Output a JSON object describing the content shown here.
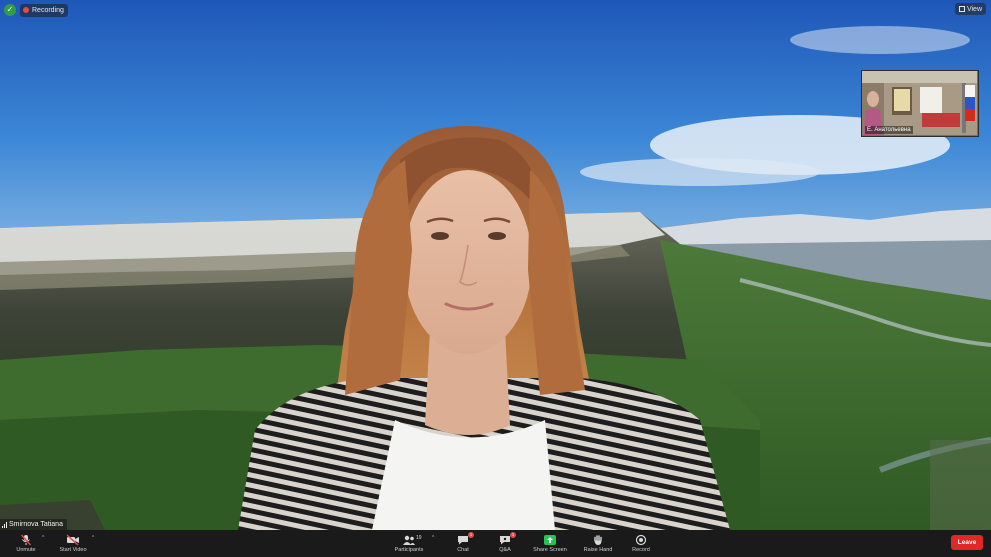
{
  "window": {
    "recording_label": "Recording",
    "view_label": "View"
  },
  "thumbnail": {
    "name": "Е. Анатольевна"
  },
  "speaker": {
    "name": "Smirnova Tatiana"
  },
  "toolbar": {
    "unmute_label": "Unmute",
    "start_video_label": "Start Video",
    "participants_label": "Participants",
    "participants_count": "19",
    "chat_label": "Chat",
    "chat_badge": "1",
    "qa_label": "Q&A",
    "qa_badge": "1",
    "share_label": "Share Screen",
    "raise_hand_label": "Raise Hand",
    "record_label": "Record",
    "leave_label": "Leave"
  },
  "colors": {
    "leave": "#e02828",
    "share": "#23c552",
    "toolbar_bg": "#1a1a1a"
  }
}
